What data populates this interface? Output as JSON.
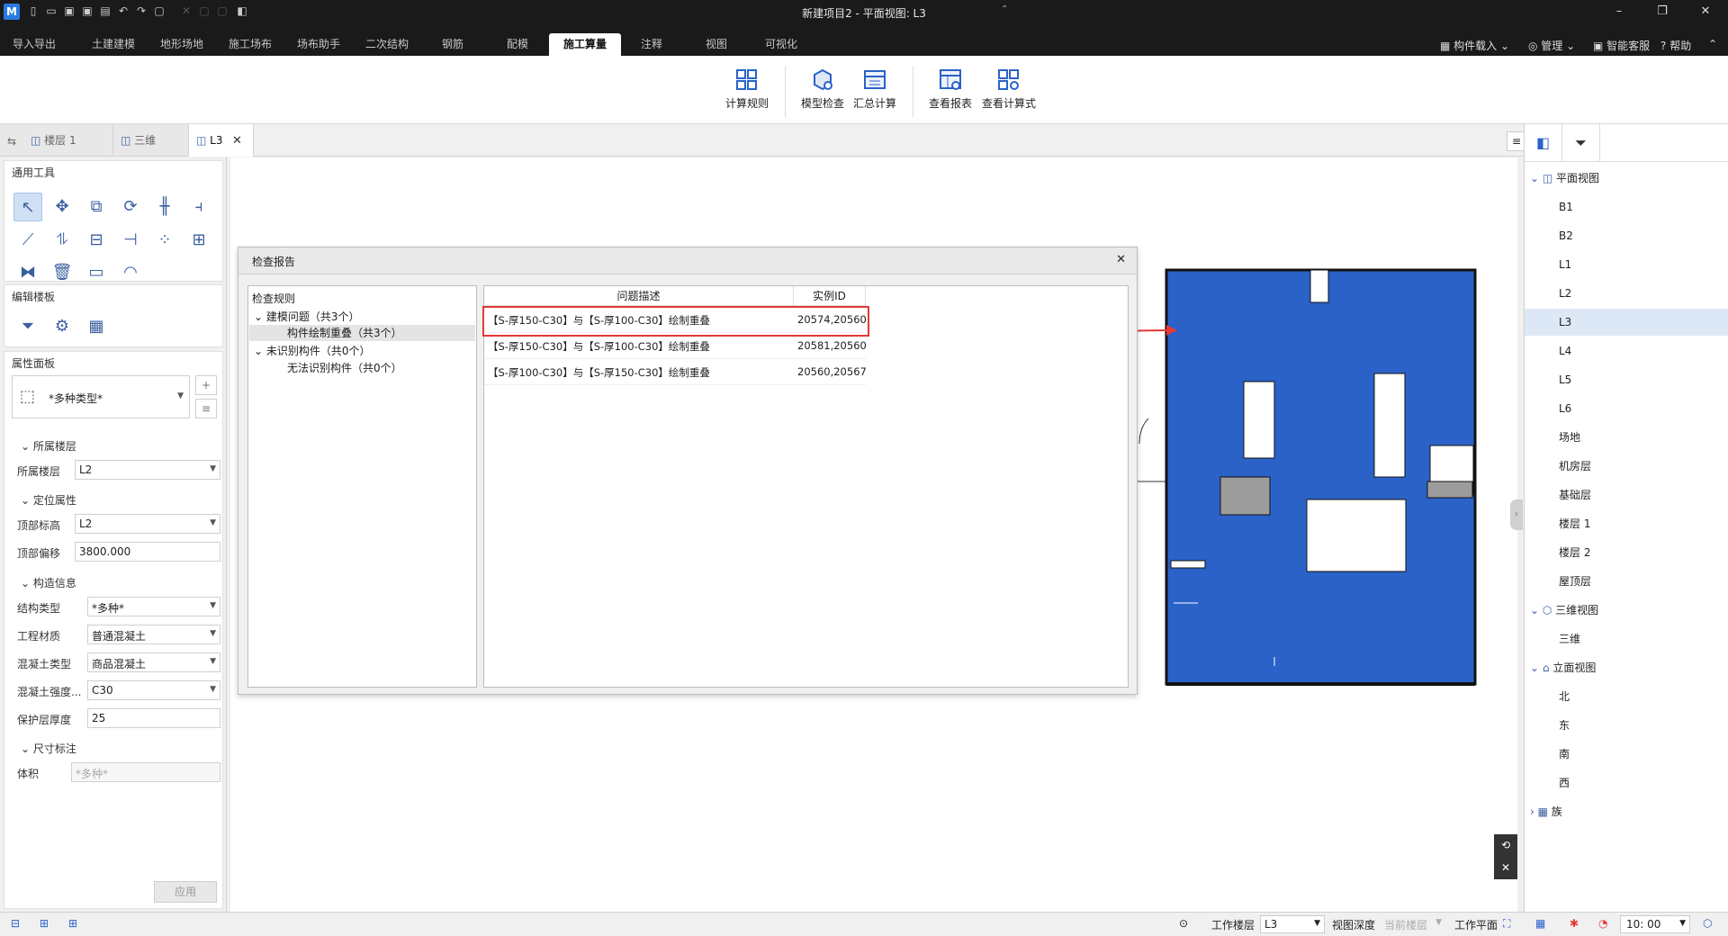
{
  "app": {
    "title": "新建项目2 - 平面视图: L3",
    "logo": "M"
  },
  "quick_access": [
    "new-file-icon",
    "open-folder-icon",
    "save-icon",
    "save-as-icon",
    "export-icon",
    "undo-icon",
    "redo-icon",
    "select-icon",
    "cut-icon",
    "copy-icon",
    "paste-icon",
    "layer-icon"
  ],
  "menu": {
    "tabs": [
      "导入导出",
      "土建建模",
      "地形场地",
      "施工场布",
      "场布助手",
      "二次结构",
      "钢筋",
      "配模",
      "施工算量",
      "注释",
      "视图",
      "可视化"
    ],
    "active": "施工算量",
    "right": [
      "构件载入",
      "管理",
      "智能客服",
      "帮助"
    ]
  },
  "ribbon": {
    "buttons": [
      "计算规则",
      "模型检查",
      "汇总计算",
      "查看报表",
      "查看计算式"
    ]
  },
  "doc_tabs": [
    "楼层 1",
    "三维",
    "L3"
  ],
  "left_panel": {
    "tools_title": "通用工具",
    "edit_title": "编辑楼板",
    "props_title": "属性面板",
    "type_value": "*多种类型*",
    "groups": {
      "floor": "所属楼层",
      "position": "定位属性",
      "construct": "构造信息",
      "dim": "尺寸标注"
    },
    "props": {
      "floor_label": "所属楼层",
      "floor_value": "L2",
      "top_level_label": "顶部标高",
      "top_level_value": "L2",
      "top_offset_label": "顶部偏移",
      "top_offset_value": "3800.000",
      "struct_type_label": "结构类型",
      "struct_type_value": "*多种*",
      "material_label": "工程材质",
      "material_value": "普通混凝土",
      "concrete_type_label": "混凝土类型",
      "concrete_type_value": "商品混凝土",
      "strength_label": "混凝土强度...",
      "strength_value": "C30",
      "cover_label": "保护层厚度",
      "cover_value": "25",
      "volume_label": "体积",
      "volume_value": "*多种*"
    },
    "apply": "应用"
  },
  "dialog": {
    "title": "检查报告",
    "tree_header": "检查规则",
    "tree": [
      {
        "label": "建模问题（共3个）",
        "expanded": true
      },
      {
        "label": "构件绘制重叠（共3个）"
      },
      {
        "label": "未识别构件（共0个）",
        "expanded": true
      },
      {
        "label": "无法识别构件（共0个）"
      }
    ],
    "columns": [
      "问题描述",
      "实例ID"
    ],
    "rows": [
      [
        "【S-厚150-C30】与【S-厚100-C30】绘制重叠",
        "20574,20560"
      ],
      [
        "【S-厚150-C30】与【S-厚100-C30】绘制重叠",
        "20581,20560"
      ],
      [
        "【S-厚100-C30】与【S-厚150-C30】绘制重叠",
        "20560,20567"
      ]
    ]
  },
  "right_panel": {
    "plan": "平面视图",
    "plan_items": [
      "B1",
      "B2",
      "L1",
      "L2",
      "L3",
      "L4",
      "L5",
      "L6",
      "场地",
      "机房层",
      "基础层",
      "楼层 1",
      "楼层 2",
      "屋顶层"
    ],
    "selected": "L3",
    "three_d": "三维视图",
    "three_d_items": [
      "三维"
    ],
    "elev": "立面视图",
    "elev_items": [
      "北",
      "东",
      "南",
      "西"
    ],
    "family": "族"
  },
  "status": {
    "work_floor_label": "工作楼层",
    "work_floor_value": "L3",
    "view_depth_label": "视图深度",
    "view_depth_value": "当前楼层",
    "work_plane_label": "工作平面",
    "zoom": "10: 00"
  },
  "colors": {
    "accent": "#2b62c8",
    "highlight": "#e53935"
  }
}
